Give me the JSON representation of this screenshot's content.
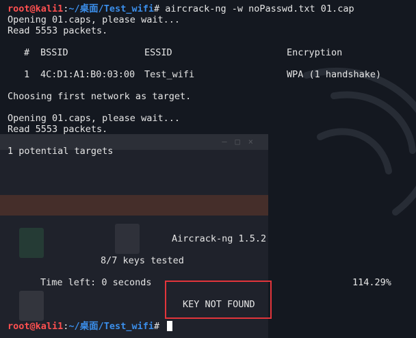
{
  "terminal": {
    "prompt": {
      "user": "root@kali1",
      "sep": ":",
      "path": "~/桌面/Test_wifi",
      "symbol": "#"
    },
    "command": " aircrack-ng -w noPasswd.txt 01.cap",
    "output": {
      "opening_1": "Opening 01.caps, please wait...",
      "read_1": "Read 5553 packets.",
      "table": {
        "headers": [
          "#",
          "BSSID",
          "ESSID",
          "Encryption"
        ],
        "row": [
          "1",
          "4C:D1:A1:B0:03:00",
          "Test_wifi",
          "WPA (1 handshake)"
        ]
      },
      "choosing": "Choosing first network as target.",
      "opening_2": "Opening 01.caps, please wait...",
      "read_2": "Read 5553 packets.",
      "targets": "1 potential targets",
      "version": "Aircrack-ng 1.5.2",
      "keys_tested": "8/7 keys tested",
      "time_left": "Time left: 0 seconds",
      "percent": "114.29%",
      "result": "KEY NOT FOUND"
    },
    "final_prompt": {
      "user": "root@kali1",
      "sep": ":",
      "path": "~/桌面/Test_wifi",
      "symbol": "#"
    }
  },
  "colors": {
    "background": "#141820",
    "prompt_user": "#ff5050",
    "prompt_path": "#3b8eea",
    "highlight_box": "#e3353b"
  }
}
